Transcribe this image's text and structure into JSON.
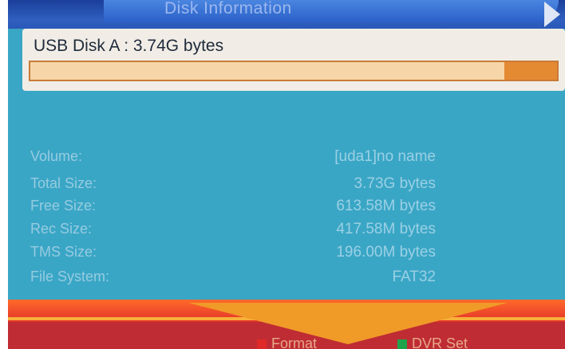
{
  "title": "Disk Information",
  "disk": {
    "label": "USB Disk A : 3.74G bytes",
    "usage_fraction": 0.9
  },
  "info": [
    {
      "label": "Volume:",
      "value": "[uda1]no name"
    },
    {
      "label": "Total Size:",
      "value": "3.73G bytes"
    },
    {
      "label": "Free Size:",
      "value": "613.58M bytes"
    },
    {
      "label": "Rec Size:",
      "value": "417.58M bytes"
    },
    {
      "label": "TMS Size:",
      "value": "196.00M bytes"
    },
    {
      "label": "File System:",
      "value": "FAT32"
    }
  ],
  "footer": {
    "format_label": "Format",
    "format_color": "#e02a2a",
    "dvr_label": "DVR Set",
    "dvr_color": "#1fa34a"
  },
  "colors": {
    "background": "#3aa6c6",
    "bar_used": "#f6d6a8",
    "bar_free": "#e48a32"
  }
}
